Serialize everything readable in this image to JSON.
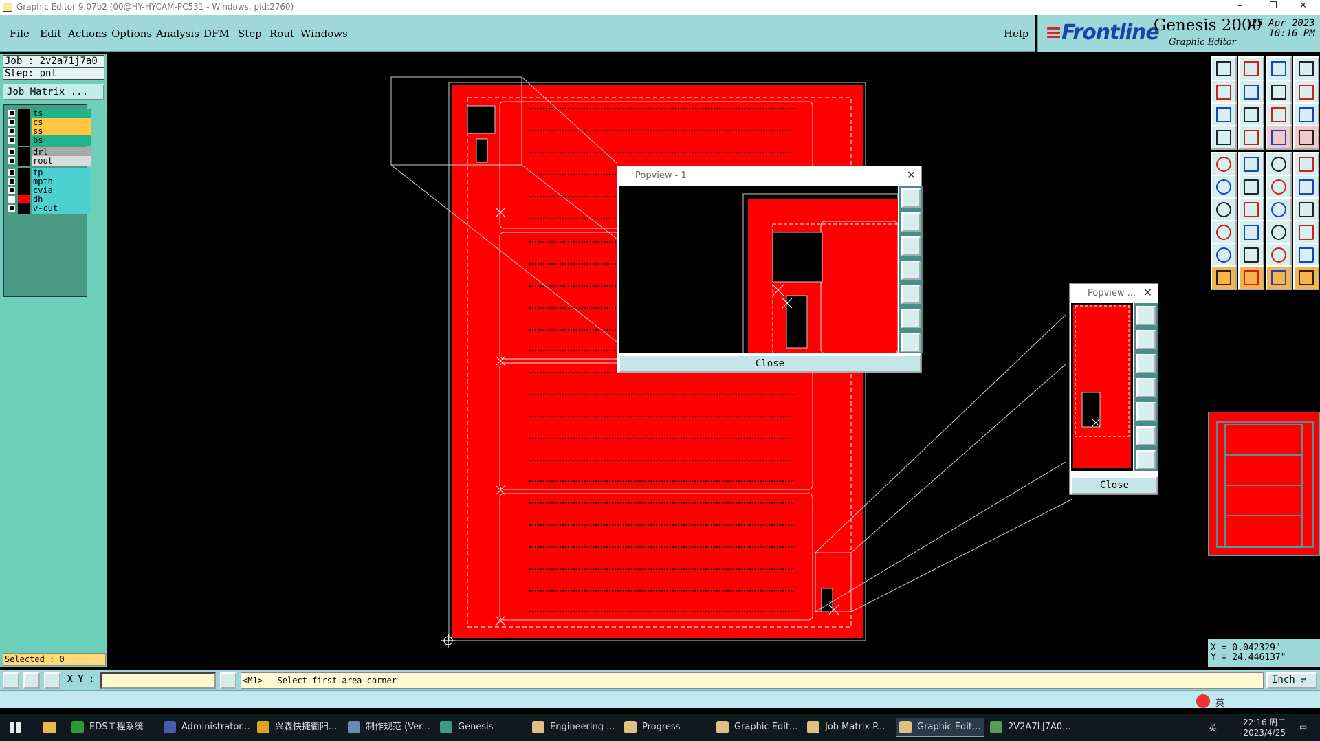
{
  "window": {
    "title": "Graphic Editor 9.07b2 (00@HY-HYCAM-PC531 - Windows, pid:2760)",
    "minimize": "–",
    "maximize": "❐",
    "close": "✕"
  },
  "menu": {
    "items": [
      "File",
      "Edit",
      "Actions",
      "Options",
      "Analysis",
      "DFM",
      "Step",
      "Rout",
      "Windows"
    ],
    "help": "Help"
  },
  "brand": {
    "frontline": "Frontline",
    "product": "Genesis 2000",
    "subtitle": "Graphic Editor",
    "date": "25 Apr 2023",
    "time": "10:16 PM"
  },
  "job": {
    "job_label": "Job : 2v2a71j7a0",
    "step_label": "Step: pnl",
    "job_matrix_button": "Job Matrix ..."
  },
  "layers": [
    {
      "name": "ts",
      "color": "#1fb48c",
      "selected": false
    },
    {
      "name": "cs",
      "color": "#ffc840",
      "selected": false
    },
    {
      "name": "ss",
      "color": "#ffc840",
      "selected": false
    },
    {
      "name": "bs",
      "color": "#1fb48c",
      "selected": false
    },
    {
      "name": "drl",
      "color": "#a9a9a9",
      "selected": false
    },
    {
      "name": "rout",
      "color": "#dcdcdc",
      "selected": false
    },
    {
      "name": "tp",
      "color": "#4dd0d0",
      "selected": false
    },
    {
      "name": "mpth",
      "color": "#4dd0d0",
      "selected": false
    },
    {
      "name": "cvia",
      "color": "#4dd0d0",
      "selected": false
    },
    {
      "name": "dh",
      "color": "#4dd0d0",
      "selected": true,
      "swatch": "#ff0000"
    },
    {
      "name": "v-cut",
      "color": "#4dd0d0",
      "selected": false
    }
  ],
  "selection": {
    "label": "Selected : 0"
  },
  "command": {
    "xy_label": "X Y :",
    "xy_value": "",
    "prompt": "<M1> - Select first area corner",
    "units": "Inch"
  },
  "coords": {
    "x": "X = 0.042329\"",
    "y": "Y = 24.446137\""
  },
  "popview1": {
    "title": "Popview - 1",
    "close_label": "Close"
  },
  "popview2": {
    "title": "Popview ...",
    "close_label": "Close"
  },
  "ime": {
    "text": "英"
  },
  "taskbar": {
    "tasks": [
      {
        "label": "EDS工程系统",
        "icon_color": "#2a9a3a"
      },
      {
        "label": "Administrator...",
        "icon_color": "#4a5ab0"
      },
      {
        "label": "兴森快捷衢阳...",
        "icon_color": "#e0a020"
      },
      {
        "label": "制作规范 (Ver...",
        "icon_color": "#6a8ab0"
      },
      {
        "label": "Genesis",
        "icon_color": "#3a9a8a"
      },
      {
        "label": "Engineering ...",
        "icon_color": "#e0c080"
      },
      {
        "label": "Progress",
        "icon_color": "#e0c080"
      },
      {
        "label": "Graphic Edit...",
        "icon_color": "#e0c080"
      },
      {
        "label": "Job Matrix P...",
        "icon_color": "#e0c080"
      },
      {
        "label": "Graphic Edit...",
        "icon_color": "#e0c080",
        "active": true
      },
      {
        "label": "2V2A7LJ7A0...",
        "icon_color": "#5a9a5a"
      }
    ],
    "tray_lang": "英",
    "clock_time": "22:16 周二",
    "clock_date": "2023/4/25"
  }
}
